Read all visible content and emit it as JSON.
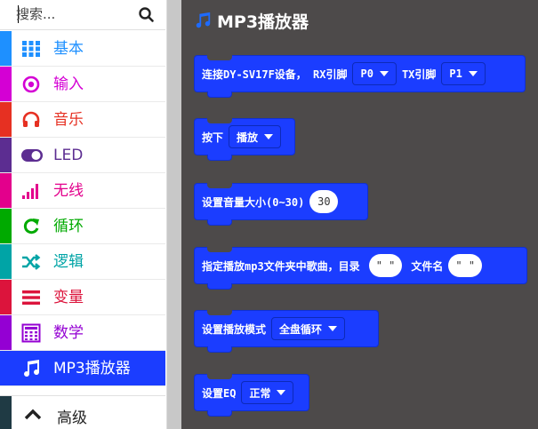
{
  "search": {
    "placeholder": "搜索..."
  },
  "categories": [
    {
      "label": "基本",
      "color": "#1e90ff",
      "icon": "grid-icon"
    },
    {
      "label": "输入",
      "color": "#d400d4",
      "icon": "target-icon"
    },
    {
      "label": "音乐",
      "color": "#e63022",
      "icon": "headphones-icon"
    },
    {
      "label": "LED",
      "color": "#5c2d91",
      "icon": "toggle-icon"
    },
    {
      "label": "无线",
      "color": "#e3008c",
      "icon": "signal-bars-icon"
    },
    {
      "label": "循环",
      "color": "#00aa00",
      "icon": "refresh-icon"
    },
    {
      "label": "逻辑",
      "color": "#00a4a6",
      "icon": "shuffle-icon"
    },
    {
      "label": "变量",
      "color": "#dc143c",
      "icon": "list-icon"
    },
    {
      "label": "数学",
      "color": "#9400d3",
      "icon": "calculator-icon"
    },
    {
      "label": "MP3播放器",
      "color": "#1b3dff",
      "icon": "music-note-icon"
    }
  ],
  "advanced": {
    "label": "高级",
    "icon": "chevron-up-icon"
  },
  "workspace": {
    "title": "MP3播放器",
    "blocks": {
      "connect": {
        "text_a": "连接DY-SV17F设备，  RX引脚",
        "rx": "P0",
        "text_b": "TX引脚",
        "tx": "P1"
      },
      "press": {
        "text": "按下",
        "action": "播放"
      },
      "volume": {
        "text": "设置音量大小(0~30)",
        "value": "30"
      },
      "play_song": {
        "text_a": "指定播放mp3文件夹中歌曲，目录",
        "folder": "\" \"",
        "text_b": "文件名",
        "file": "\" \""
      },
      "mode": {
        "text": "设置播放模式",
        "value": "全盘循环"
      },
      "eq": {
        "text": "设置EQ",
        "value": "正常"
      }
    }
  }
}
